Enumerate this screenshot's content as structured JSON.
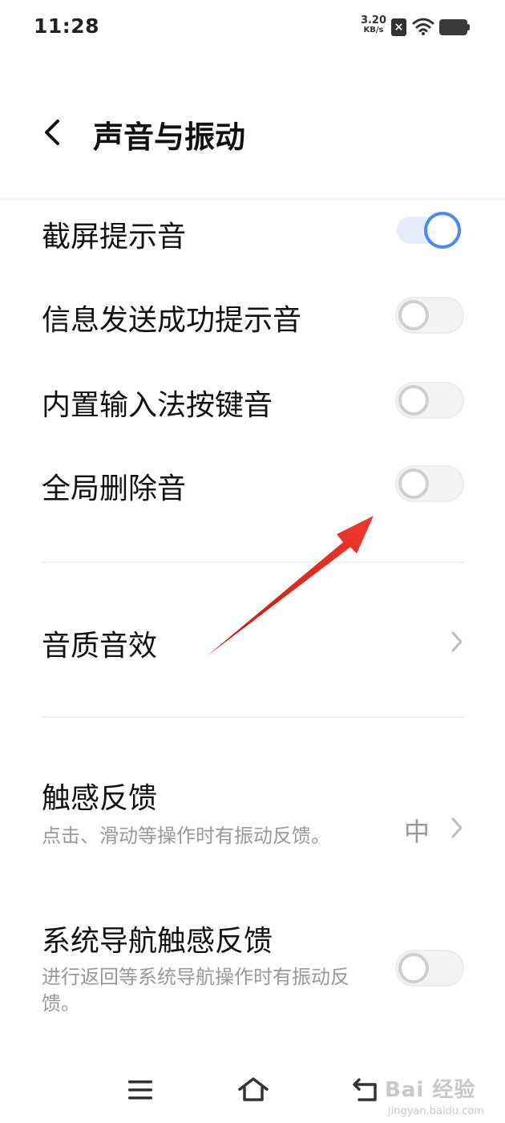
{
  "status_bar": {
    "time": "11:28",
    "net_speed_value": "3.20",
    "net_speed_unit": "KB/s",
    "sim_icon": "sim-x-icon",
    "wifi_icon": "wifi-icon",
    "battery_icon": "battery-icon"
  },
  "header": {
    "back_icon": "chevron-left-icon",
    "title": "声音与振动"
  },
  "settings": {
    "screenshot_sound": {
      "label": "截屏提示音",
      "enabled": true
    },
    "message_sent_sound": {
      "label": "信息发送成功提示音",
      "enabled": false
    },
    "keyboard_sound": {
      "label": "内置输入法按键音",
      "enabled": false
    },
    "global_delete_sound": {
      "label": "全局删除音",
      "enabled": false
    },
    "sound_quality": {
      "label": "音质音效"
    },
    "haptic_feedback": {
      "label": "触感反馈",
      "description": "点击、滑动等操作时有振动反馈。",
      "value": "中"
    },
    "nav_haptic_feedback": {
      "label": "系统导航触感反馈",
      "description": "进行返回等系统导航操作时有振动反馈。",
      "enabled": false
    }
  },
  "nav_bar": {
    "menu_icon": "menu-icon",
    "home_icon": "home-icon",
    "back_icon": "back-return-icon"
  },
  "watermark": {
    "brand": "Bai 经验",
    "url": "jingyan.baidu.com"
  },
  "colors": {
    "accent": "#4b89ec",
    "arrow": "#e8261f",
    "secondary_text": "#999999"
  }
}
